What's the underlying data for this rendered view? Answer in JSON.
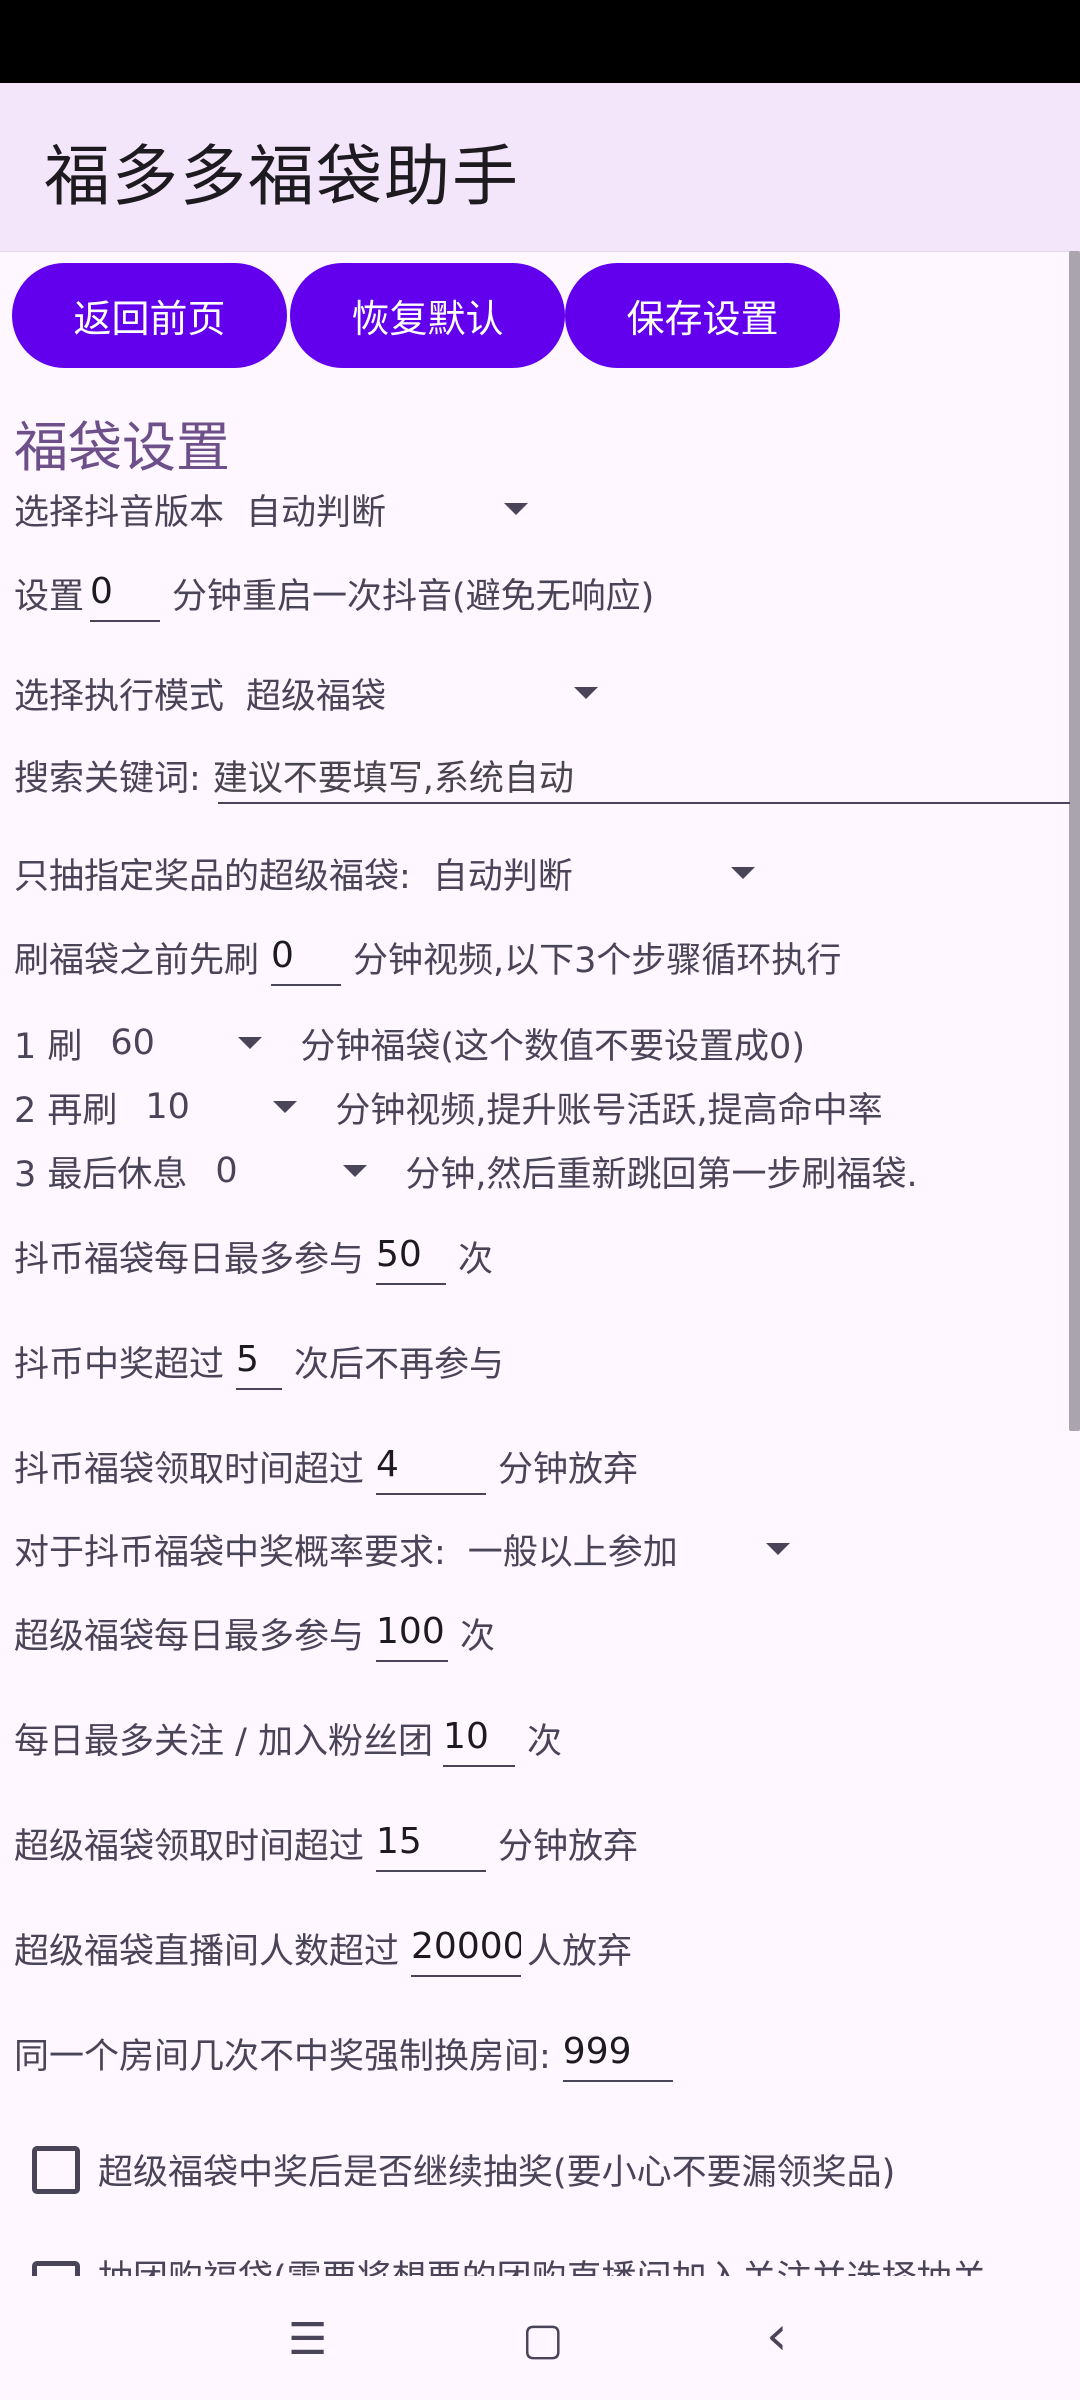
{
  "app": {
    "title": "福多多福袋助手"
  },
  "toolbar": {
    "back_label": "返回前页",
    "reset_label": "恢复默认",
    "save_label": "保存设置"
  },
  "section": {
    "title": "福袋设置"
  },
  "douyin_version": {
    "label": "选择抖音版本",
    "value": "自动判断"
  },
  "restart": {
    "prefix": "设置",
    "value": "0",
    "suffix": "分钟重启一次抖音(避免无响应)"
  },
  "mode": {
    "label": "选择执行模式",
    "value": "超级福袋"
  },
  "search": {
    "label": "搜索关键词:",
    "placeholder": "建议不要填写,系统自动"
  },
  "prize_filter": {
    "label": "只抽指定奖品的超级福袋:",
    "value": "自动判断"
  },
  "pre_video": {
    "prefix": "刷福袋之前先刷",
    "value": "0",
    "suffix": "分钟视频,以下3个步骤循环执行"
  },
  "step1": {
    "label": "1 刷",
    "value": "60",
    "suffix": "分钟福袋(这个数值不要设置成0)"
  },
  "step2": {
    "label": "2 再刷",
    "value": "10",
    "suffix": "分钟视频,提升账号活跃,提高命中率"
  },
  "step3": {
    "label": "3 最后休息",
    "value": "0",
    "suffix": "分钟,然后重新跳回第一步刷福袋."
  },
  "coin_daily": {
    "prefix": "抖币福袋每日最多参与",
    "value": "50",
    "suffix": "次"
  },
  "coin_win": {
    "prefix": "抖币中奖超过",
    "value": "5",
    "suffix": "次后不再参与"
  },
  "coin_time": {
    "prefix": "抖币福袋领取时间超过",
    "value": "4",
    "suffix": "分钟放弃"
  },
  "coin_prob": {
    "label": "对于抖币福袋中奖概率要求:",
    "value": "一般以上参加"
  },
  "super_daily": {
    "prefix": "超级福袋每日最多参与",
    "value": "100",
    "suffix": "次"
  },
  "follow_daily": {
    "prefix": "每日最多关注 / 加入粉丝团",
    "value": "10",
    "suffix": "次"
  },
  "super_time": {
    "prefix": "超级福袋领取时间超过",
    "value": "15",
    "suffix": "分钟放弃"
  },
  "super_viewers": {
    "prefix": "超级福袋直播间人数超过",
    "value": "20000",
    "suffix": "人放弃"
  },
  "room_switch": {
    "prefix": "同一个房间几次不中奖强制换房间:",
    "value": "999"
  },
  "checkbox1": {
    "label": "超级福袋中奖后是否继续抽奖(要小心不要漏领奖品)"
  },
  "checkbox2": {
    "label": "抽团购福袋(需要将想要的团购直播间加入关注并选择抽关"
  },
  "navbar": {
    "menu_icon": "☰",
    "home_icon": "▢",
    "back_icon": "‹"
  }
}
